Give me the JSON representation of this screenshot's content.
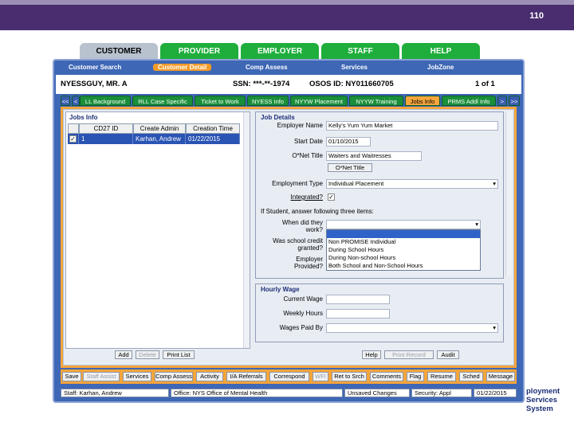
{
  "slide_number": "110",
  "top_tabs": [
    "CUSTOMER",
    "PROVIDER",
    "EMPLOYER",
    "STAFF",
    "HELP"
  ],
  "sub_nav": [
    "Customer Search",
    "Customer Detail",
    "Comp Assess",
    "Services",
    "JobZone"
  ],
  "info_bar": {
    "name": "NYESSGUY, MR. A",
    "ssn": "SSN: ***-**-1974",
    "osos": "OSOS ID: NY011660705",
    "pager": "1 of 1"
  },
  "content_tabs": [
    "<<",
    "<",
    "LL Background",
    "RLL Case Specific",
    "Ticket to Work",
    "NYESS Info",
    "NYYW Placement",
    "NYYW Training",
    "Jobs Info",
    "PRMS Addl Info",
    ">",
    ">>"
  ],
  "jobs_info": {
    "title": "Jobs Info",
    "headers": [
      "CD27 ID",
      "Create Admin",
      "Creation Time"
    ],
    "row": {
      "check": "✓",
      "id": "1",
      "admin": "Karhan, Andrew",
      "time": "01/22/2015"
    },
    "buttons": [
      "Add",
      "Delete",
      "Print List"
    ]
  },
  "job_details": {
    "title": "Job Details",
    "employer_label": "Employer Name",
    "employer_value": "Kelly's Yum Yum Market",
    "start_label": "Start Date",
    "start_value": "01/10/2015",
    "onet_label": "O*Net Title",
    "onet_value": "Waiters and Waitresses",
    "onet_button": "O*Net Title",
    "emp_type_label": "Employment Type",
    "emp_type_value": "Individual Placement",
    "integrated_label": "Integrated?",
    "student_text": "If Student, answer following three items:",
    "when_label_1": "When did they",
    "when_label_2": "work?",
    "school_label_1": "Was school credit",
    "school_label_2": "granted?",
    "employer_label_1": "Employer",
    "employer_label_2": "Provided?",
    "dropdown_options": [
      "",
      "Non PROMISE Individual",
      "During School Hours",
      "During Non-school Hours",
      "Both School and Non-School Hours"
    ]
  },
  "hourly_wage": {
    "title": "Hourly Wage",
    "current_label": "Current Wage",
    "weekly_label": "Weekly Hours",
    "paid_label": "Wages Paid By"
  },
  "detail_buttons": [
    "Help",
    "Print Record",
    "Audit"
  ],
  "bottom_buttons": [
    "Save",
    "Staff Assist",
    "Services",
    "Comp Assess",
    "Activity",
    "I/A Referrals",
    "Correspond",
    "WFI",
    "Ret to Srch",
    "Comments",
    "Flag",
    "Resume",
    "Sched",
    "Message"
  ],
  "status": {
    "staff": "Staff: Karhan, Andrew",
    "office": "Office: NYS Office of Mental Health",
    "unsaved": "Unsaved Changes",
    "security": "Security: Appl",
    "date": "01/22/2015"
  },
  "logo": {
    "line1": "ployment",
    "line2": "Services System"
  },
  "colors": {
    "accent_orange": "#f5a53b",
    "app_blue": "#3e67b5",
    "tab_green": "#1fae3c",
    "header_purple": "#4a2d6e"
  }
}
